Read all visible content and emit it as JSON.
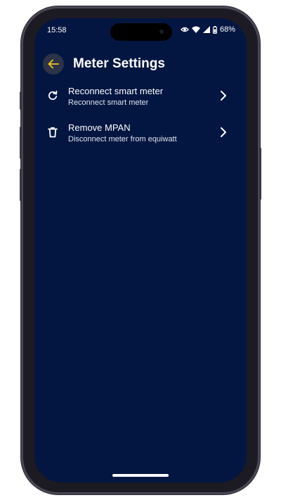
{
  "status_bar": {
    "time": "15:58",
    "battery": "68%",
    "icons": [
      "eye-icon",
      "wifi-icon",
      "signal-icon",
      "battery-icon"
    ]
  },
  "header": {
    "title": "Meter Settings",
    "back_icon": "arrow-left-icon"
  },
  "settings": [
    {
      "icon": "refresh-icon",
      "title": "Reconnect smart meter",
      "subtitle": "Reconnect smart meter"
    },
    {
      "icon": "trash-icon",
      "title": "Remove MPAN",
      "subtitle": "Disconnect meter from equiwatt"
    }
  ],
  "colors": {
    "background": "#021641",
    "accent": "#f5c518",
    "text": "#ffffff",
    "back_button_bg": "#2a3347"
  }
}
